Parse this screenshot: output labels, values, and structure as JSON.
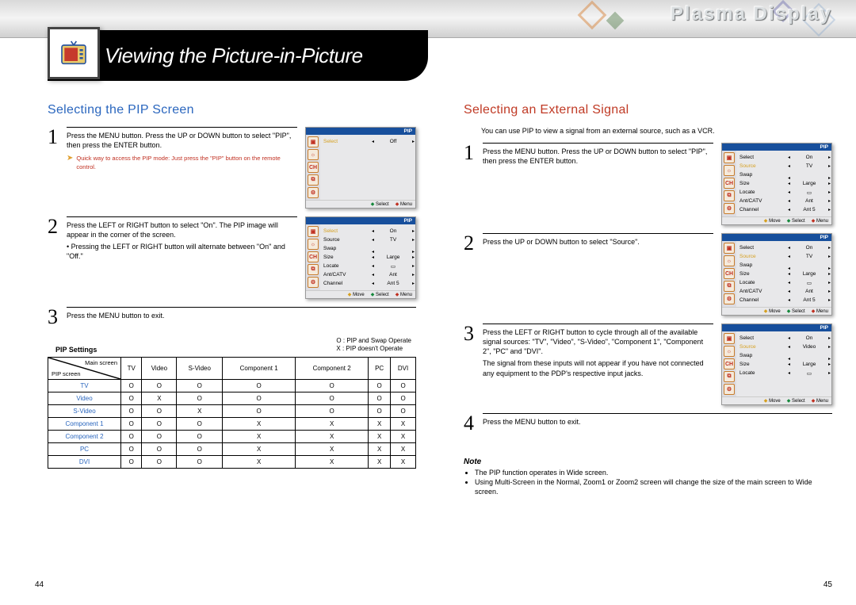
{
  "brand": "Plasma Display",
  "page_title": "Viewing the Picture-in-Picture",
  "left": {
    "heading": "Selecting the PIP Screen",
    "steps": [
      {
        "body": "Press the MENU button. Press the UP or DOWN button to select \"PIP\", then press the ENTER button.",
        "hint": "Quick way to access the PIP mode: Just press the \"PIP\" button on the remote control."
      },
      {
        "body": "Press the LEFT or RIGHT button to select \"On\". The PIP image will appear in the corner of the screen.",
        "sub": "• Pressing the LEFT or RIGHT button will alternate between \"On\" and \"Off.\""
      },
      {
        "body": "Press the MENU button to exit."
      }
    ],
    "settings_title": "PIP Settings",
    "legend": {
      "o": "O :  PIP and Swap Operate",
      "x": "X :  PIP doesn't Operate"
    },
    "table": {
      "diag_top": "Main screen",
      "diag_bot": "PIP screen",
      "cols": [
        "TV",
        "Video",
        "S-Video",
        "Component 1",
        "Component 2",
        "PC",
        "DVI"
      ],
      "rows": [
        {
          "label": "TV",
          "cells": [
            "O",
            "O",
            "O",
            "O",
            "O",
            "O",
            "O"
          ]
        },
        {
          "label": "Video",
          "cells": [
            "O",
            "X",
            "O",
            "O",
            "O",
            "O",
            "O"
          ]
        },
        {
          "label": "S-Video",
          "cells": [
            "O",
            "O",
            "X",
            "O",
            "O",
            "O",
            "O"
          ]
        },
        {
          "label": "Component 1",
          "cells": [
            "O",
            "O",
            "O",
            "X",
            "X",
            "X",
            "X"
          ]
        },
        {
          "label": "Component 2",
          "cells": [
            "O",
            "O",
            "O",
            "X",
            "X",
            "X",
            "X"
          ]
        },
        {
          "label": "PC",
          "cells": [
            "O",
            "O",
            "O",
            "X",
            "X",
            "X",
            "X"
          ]
        },
        {
          "label": "DVI",
          "cells": [
            "O",
            "O",
            "O",
            "X",
            "X",
            "X",
            "X"
          ]
        }
      ]
    }
  },
  "right": {
    "heading": "Selecting an External Signal",
    "intro": "You can use PIP to view a signal from an external source, such as a VCR.",
    "steps": [
      {
        "body": "Press the MENU button. Press the UP or DOWN button to select \"PIP\", then press the ENTER button."
      },
      {
        "body": "Press the UP or DOWN button to select \"Source\"."
      },
      {
        "body": "Press the LEFT or RIGHT button to cycle through all of the available signal sources: \"TV\", \"Video\", \"S-Video\", \"Component 1\", \"Component 2\", \"PC\" and \"DVI\".",
        "sub": "The signal from these inputs will not appear if you have not connected any equipment to the PDP's respective input jacks."
      },
      {
        "body": "Press the MENU button to exit."
      }
    ],
    "note_heading": "Note",
    "notes": [
      "The PIP function operates in Wide screen.",
      "Using Multi-Screen in the Normal, Zoom1 or Zoom2 screen will change the size of the main screen to Wide screen."
    ]
  },
  "osd": {
    "header": "PIP",
    "footer_move": "Move",
    "footer_select": "Select",
    "footer_menu": "Menu",
    "icons": [
      "▣",
      "☼",
      "CH",
      "⧉",
      "⚙"
    ],
    "screens": {
      "off": [
        {
          "lab": "Select",
          "val": "Off",
          "hot": true
        }
      ],
      "on_full": [
        {
          "lab": "Select",
          "val": "On",
          "hot": true
        },
        {
          "lab": "Source",
          "val": "TV"
        },
        {
          "lab": "Swap",
          "val": ""
        },
        {
          "lab": "Size",
          "val": "Large"
        },
        {
          "lab": "Locate",
          "val": "▭"
        },
        {
          "lab": "Ant/CATV",
          "val": "Ant"
        },
        {
          "lab": "Channel",
          "val": "Ant 5"
        }
      ],
      "on_src": [
        {
          "lab": "Select",
          "val": "On"
        },
        {
          "lab": "Source",
          "val": "TV",
          "hot": true
        },
        {
          "lab": "Swap",
          "val": ""
        },
        {
          "lab": "Size",
          "val": "Large"
        },
        {
          "lab": "Locate",
          "val": "▭"
        },
        {
          "lab": "Ant/CATV",
          "val": "Ant"
        },
        {
          "lab": "Channel",
          "val": "Ant 5"
        }
      ],
      "src_tv": [
        {
          "lab": "Select",
          "val": "On"
        },
        {
          "lab": "Source",
          "val": "TV",
          "hot": true
        },
        {
          "lab": "Swap",
          "val": ""
        },
        {
          "lab": "Size",
          "val": "Large"
        },
        {
          "lab": "Locate",
          "val": "▭"
        },
        {
          "lab": "Ant/CATV",
          "val": "Ant"
        },
        {
          "lab": "Channel",
          "val": "Ant 5"
        }
      ],
      "src_vid": [
        {
          "lab": "Select",
          "val": "On"
        },
        {
          "lab": "Source",
          "val": "Video",
          "hot": true
        },
        {
          "lab": "Swap",
          "val": ""
        },
        {
          "lab": "Size",
          "val": "Large"
        },
        {
          "lab": "Locate",
          "val": "▭"
        }
      ]
    }
  },
  "page_left": "44",
  "page_right": "45"
}
